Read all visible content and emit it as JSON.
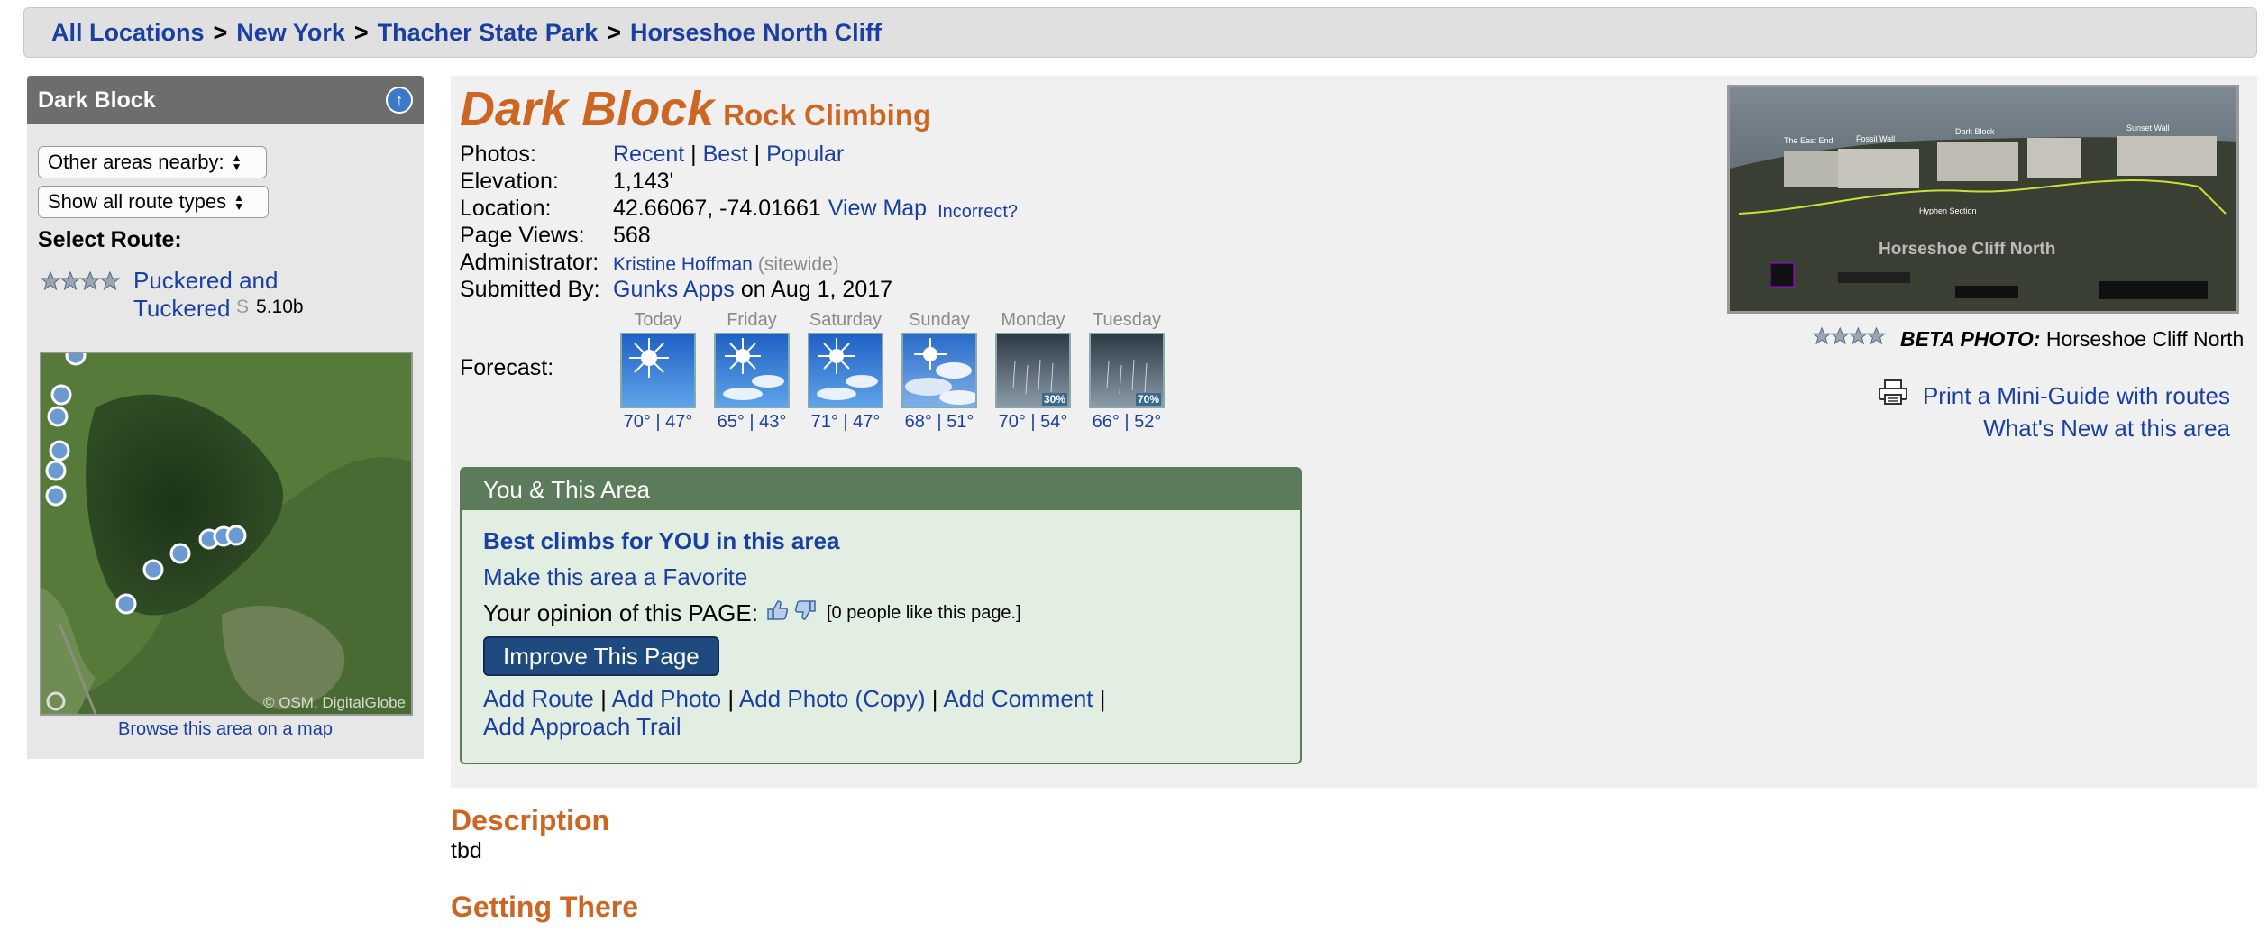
{
  "breadcrumb": {
    "items": [
      "All Locations",
      "New York",
      "Thacher State Park",
      "Horseshoe North Cliff"
    ],
    "separator": ">"
  },
  "sidebar": {
    "title": "Dark Block",
    "other_areas_select": "Other areas nearby:",
    "route_types_select": "Show all route types",
    "select_route_label": "Select Route:",
    "route": {
      "name_line1": "Puckered and",
      "name_line2": "Tuckered",
      "type": "S",
      "grade": "5.10b",
      "stars": 4
    },
    "map_attribution": "© OSM, DigitalGlobe",
    "browse_link": "Browse this area on a map"
  },
  "main": {
    "title": "Dark Block",
    "subtitle": "Rock Climbing",
    "photos_label": "Photos:",
    "photos_links": [
      "Recent",
      "Best",
      "Popular"
    ],
    "photos_sep": "|",
    "elevation_label": "Elevation:",
    "elevation": "1,143'",
    "location_label": "Location:",
    "location": "42.66067, -74.01661",
    "view_map": "View Map",
    "incorrect": "Incorrect?",
    "page_views_label": "Page Views:",
    "page_views": "568",
    "admin_label": "Administrator:",
    "admin_name": "Kristine Hoffman",
    "admin_scope": "(sitewide)",
    "submitted_label": "Submitted By:",
    "submitted_by": "Gunks Apps",
    "submitted_date": "on Aug 1, 2017",
    "forecast_label": "Forecast:",
    "forecast": [
      {
        "day": "Today",
        "temps": "70° | 47°",
        "icon": "sunny-icon",
        "pct": ""
      },
      {
        "day": "Friday",
        "temps": "65° | 43°",
        "icon": "sun-clouds-icon",
        "pct": ""
      },
      {
        "day": "Saturday",
        "temps": "71° | 47°",
        "icon": "sun-clouds-icon",
        "pct": ""
      },
      {
        "day": "Sunday",
        "temps": "68° | 51°",
        "icon": "partly-cloudy-icon",
        "pct": ""
      },
      {
        "day": "Monday",
        "temps": "70° | 54°",
        "icon": "rain-icon",
        "pct": "30%"
      },
      {
        "day": "Tuesday",
        "temps": "66° | 52°",
        "icon": "rain-icon",
        "pct": "70%"
      }
    ]
  },
  "you_area": {
    "header": "You & This Area",
    "best_climbs": "Best climbs for YOU in this area",
    "favorite": "Make this area a Favorite",
    "opinion_label": "Your opinion of this PAGE:",
    "opinion_note": "[0 people like this page.]",
    "improve_btn": "Improve This Page",
    "add_links": [
      "Add Route",
      "Add Photo",
      "Add Photo (Copy)",
      "Add Comment",
      "Add Approach Trail"
    ]
  },
  "photo": {
    "caption_prefix": "BETA PHOTO:",
    "caption": "Horseshoe Cliff North",
    "overlay_title": "Horseshoe Cliff North",
    "labels": [
      "The East End",
      "Fossil Wall",
      "Dark Block",
      "Sunset Wall",
      "Hyphen Section"
    ]
  },
  "print_link": "Print a Mini-Guide with routes",
  "whats_new": "What's New at this area",
  "description": {
    "heading": "Description",
    "text": "tbd"
  },
  "getting_there": {
    "heading": "Getting There"
  },
  "colors": {
    "accent": "#cc6622",
    "link": "#1a3fa0",
    "box_header": "#5b7b5b"
  }
}
